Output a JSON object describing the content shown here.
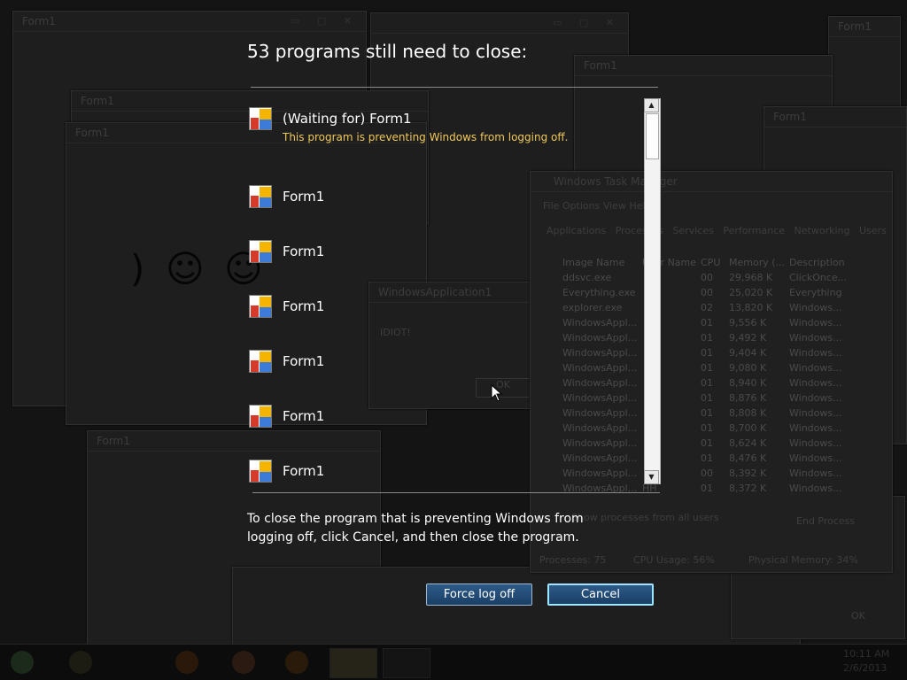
{
  "dialog": {
    "heading": "53 programs still need to close:",
    "programs": [
      {
        "name": "(Waiting for) Form1",
        "description": "This program is preventing Windows from logging off."
      },
      {
        "name": "Form1",
        "description": ""
      },
      {
        "name": "Form1",
        "description": ""
      },
      {
        "name": "Form1",
        "description": ""
      },
      {
        "name": "Form1",
        "description": ""
      },
      {
        "name": "Form1",
        "description": ""
      },
      {
        "name": "Form1",
        "description": ""
      }
    ],
    "explanation": "To close the program that is preventing Windows from logging off, click Cancel, and then close the program.",
    "force_logoff_label": "Force log off",
    "cancel_label": "Cancel",
    "scroll_up": "▲",
    "scroll_down": "▼",
    "program_icon": "application-window-icon"
  },
  "background": {
    "form_title": "Form1",
    "taskmgr_title": "Windows Task Manager",
    "taskmgr_menu": "File  Options  View  Help",
    "taskmgr_tabs": [
      "Applications",
      "Processes",
      "Services",
      "Performance",
      "Networking",
      "Users"
    ],
    "taskmgr_columns": [
      "Image Name",
      "User Name",
      "CPU",
      "Memory (...",
      "Description"
    ],
    "taskmgr_rows": [
      [
        "ddsvc.exe",
        "",
        "00",
        "29,968 K",
        "ClickOnce..."
      ],
      [
        "Everything.exe",
        "",
        "00",
        "25,020 K",
        "Everything"
      ],
      [
        "explorer.exe",
        "",
        "02",
        "13,820 K",
        "Windows..."
      ],
      [
        "WindowsAppl...",
        "",
        "01",
        "9,556 K",
        "Windows..."
      ],
      [
        "WindowsAppl...",
        "",
        "01",
        "9,492 K",
        "Windows..."
      ],
      [
        "WindowsAppl...",
        "",
        "01",
        "9,404 K",
        "Windows..."
      ],
      [
        "WindowsAppl...",
        "",
        "01",
        "9,080 K",
        "Windows..."
      ],
      [
        "WindowsAppl...",
        "",
        "01",
        "8,940 K",
        "Windows..."
      ],
      [
        "WindowsAppl...",
        "",
        "01",
        "8,876 K",
        "Windows..."
      ],
      [
        "WindowsAppl...",
        "",
        "01",
        "8,808 K",
        "Windows..."
      ],
      [
        "WindowsAppl...",
        "",
        "01",
        "8,700 K",
        "Windows..."
      ],
      [
        "WindowsAppl...",
        "",
        "01",
        "8,624 K",
        "Windows..."
      ],
      [
        "WindowsAppl...",
        "",
        "01",
        "8,476 K",
        "Windows..."
      ],
      [
        "WindowsAppl...",
        "",
        "00",
        "8,392 K",
        "Windows..."
      ],
      [
        "WindowsAppl...",
        "HH",
        "01",
        "8,372 K",
        "Windows..."
      ]
    ],
    "taskmgr_show_all": "Show processes from all users",
    "taskmgr_end_process": "End Process",
    "status_processes": "Processes: 75",
    "status_cpu": "CPU Usage: 56%",
    "status_memory": "Physical Memory: 34%",
    "msgbox_title": "WindowsApplication1",
    "msgbox_text": "IDIOT!",
    "msgbox_ok": "OK",
    "ok_label": "OK",
    "clock_time": "10:11 AM",
    "clock_date": "2/6/2013"
  }
}
